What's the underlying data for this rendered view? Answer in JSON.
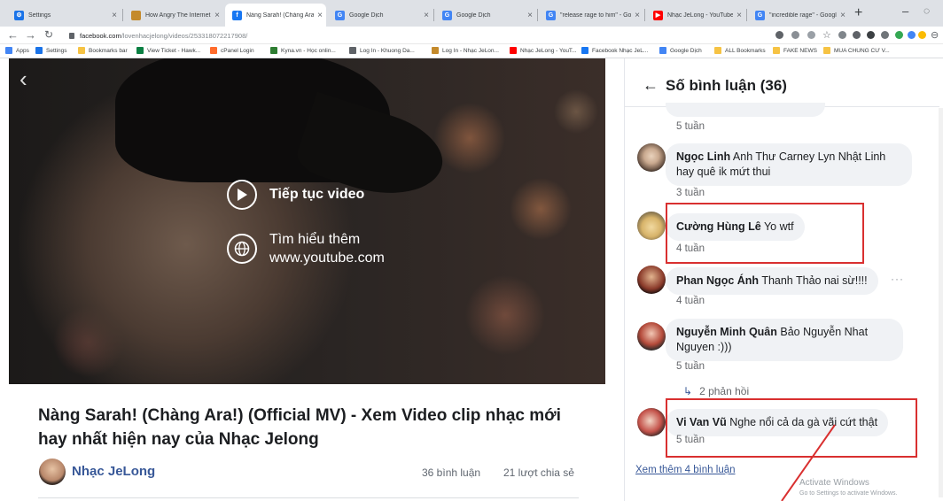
{
  "browser": {
    "tabs": [
      {
        "title": "Settings",
        "favicon_color": "#1a73e8",
        "active": false
      },
      {
        "title": "How Angry The Internet Co",
        "favicon_color": "#c48a2c",
        "active": false
      },
      {
        "title": "Nàng Sarah! (Chàng Ara!) -",
        "favicon_color": "#1877f2",
        "active": true
      },
      {
        "title": "Google Dịch",
        "favicon_color": "#4285f4",
        "active": false
      },
      {
        "title": "Google Dịch",
        "favicon_color": "#4285f4",
        "active": false
      },
      {
        "title": "\"release rage to him\" - Goo",
        "favicon_color": "#4285f4",
        "active": false
      },
      {
        "title": "Nhạc JeLong - YouTube",
        "favicon_color": "#ff0000",
        "active": false
      },
      {
        "title": "\"incredible rage\" - Google",
        "favicon_color": "#4285f4",
        "active": false
      }
    ],
    "new_tab": "+",
    "minimize": "–",
    "url_domain": "facebook.com",
    "url_path": "/lovenhacjelong/videos/253318072217908/",
    "bookmarks": [
      {
        "label": "Apps",
        "color": "#4285f4"
      },
      {
        "label": "Settings",
        "color": "#1a73e8"
      },
      {
        "label": "Bookmarks bar",
        "color": "#f6c344"
      },
      {
        "label": "View Ticket - Hawk...",
        "color": "#0b8043"
      },
      {
        "label": "cPanel Login",
        "color": "#ff6c2c"
      },
      {
        "label": "Kyna.vn - Học onlin...",
        "color": "#2e7d32"
      },
      {
        "label": "Log In - Khuong Da...",
        "color": "#5f6368"
      },
      {
        "label": "Log In - Nhạc JeLon...",
        "color": "#c48a2c"
      },
      {
        "label": "Nhạc JeLong - YouT...",
        "color": "#ff0000"
      },
      {
        "label": "Facebook Nhạc JeL...",
        "color": "#1877f2"
      },
      {
        "label": "Google Dịch",
        "color": "#4285f4"
      },
      {
        "label": "ALL Bookmarks",
        "color": "#f6c344"
      },
      {
        "label": "FAKE NEWS",
        "color": "#f6c344"
      },
      {
        "label": "MUA CHUNG CƯ V...",
        "color": "#f6c344"
      }
    ]
  },
  "video": {
    "continue_label": "Tiếp tục video",
    "learn_more_label": "Tìm hiểu thêm",
    "learn_more_url": "www.youtube.com",
    "title": "Nàng Sarah! (Chàng Ara!) (Official MV) - Xem Video clip nhạc mới hay nhất hiện nay của Nhạc Jelong",
    "channel": "Nhạc JeLong",
    "comment_count": "36 bình luận",
    "share_count": "21 lượt chia sẻ"
  },
  "comments_panel": {
    "title": "Số bình luận (36)",
    "top_time": "5 tuần",
    "comments": [
      {
        "author": "Ngọc Linh",
        "text": "Anh Thư Carney Lyn Nhật Linh hay quê ik mứt thui",
        "time": "3 tuần",
        "avatar_color": "#7b6352"
      },
      {
        "author": "Cường Hùng Lê",
        "text": "Yo wtf",
        "time": "4 tuần",
        "avatar_color": "#d8b46a"
      },
      {
        "author": "Phan Ngọc Ánh",
        "text": "Thanh Thảo nai sừ!!!!",
        "time": "4 tuần",
        "avatar_color": "#8a3a2a"
      },
      {
        "author": "Nguyễn Minh Quân",
        "text": "Bảo Nguyễn Nhat Nguyen :)))",
        "time": "5 tuần",
        "avatar_color": "#b44a3a"
      },
      {
        "author": "Vi Van Vũ",
        "text": "Nghe nổi cả da gà vãi cứt thật",
        "time": "5 tuần",
        "avatar_color": "#c4524a"
      }
    ],
    "replies_label": "2 phản hồi",
    "more_label": "Xem thêm 4 bình luận",
    "dots": "···"
  },
  "watermark": {
    "line1": "Activate Windows",
    "line2": "Go to Settings to activate Windows."
  },
  "colors": {
    "highlight": "#d93030",
    "link": "#385898"
  }
}
